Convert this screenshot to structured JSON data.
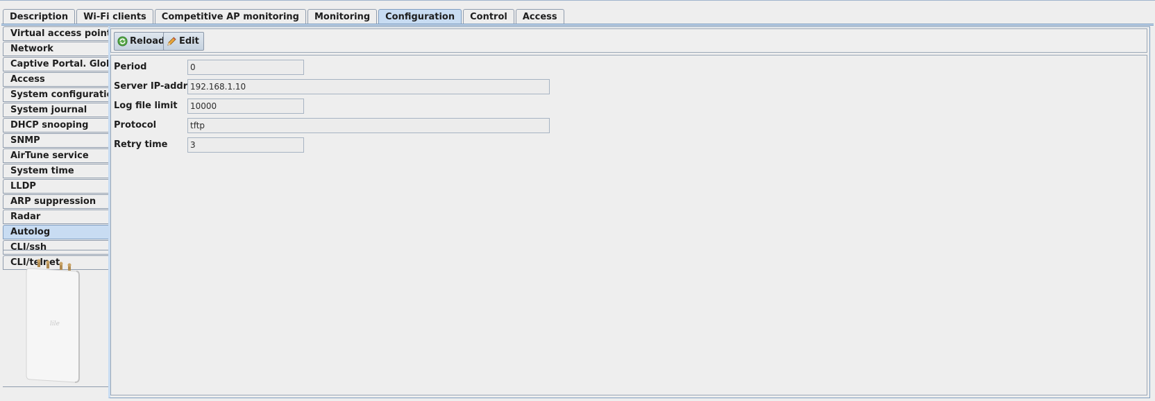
{
  "tabs": [
    {
      "label": "Description",
      "active": false
    },
    {
      "label": "Wi-Fi clients",
      "active": false
    },
    {
      "label": "Competitive AP monitoring",
      "active": false
    },
    {
      "label": "Monitoring",
      "active": false
    },
    {
      "label": "Configuration",
      "active": true
    },
    {
      "label": "Control",
      "active": false
    },
    {
      "label": "Access",
      "active": false
    }
  ],
  "sidebar": {
    "items": [
      {
        "label": "Virtual access points"
      },
      {
        "label": "Network"
      },
      {
        "label": "Captive Portal. Global"
      },
      {
        "label": "Access"
      },
      {
        "label": "System configuration"
      },
      {
        "label": "System journal"
      },
      {
        "label": "DHCP snooping"
      },
      {
        "label": "SNMP"
      },
      {
        "label": "AirTune service"
      },
      {
        "label": "System time"
      },
      {
        "label": "LLDP"
      },
      {
        "label": "ARP suppression"
      },
      {
        "label": "Radar"
      },
      {
        "label": "Autolog"
      },
      {
        "label": "CLI/ssh"
      },
      {
        "label": "CLI/telnet"
      }
    ],
    "active_item": "Autolog",
    "device_image": "access-point-device"
  },
  "toolbar": {
    "reload_label": "Reload",
    "reload_icon": "refresh-icon",
    "edit_label": "Edit",
    "edit_icon": "pencil-icon"
  },
  "form": {
    "period": {
      "label": "Period",
      "value": "0"
    },
    "server_ip": {
      "label": "Server IP-address",
      "value": "192.168.1.10"
    },
    "log_file_limit": {
      "label": "Log file limit",
      "value": "10000"
    },
    "protocol": {
      "label": "Protocol",
      "value": "tftp"
    },
    "retry_time": {
      "label": "Retry time",
      "value": "3"
    }
  },
  "colors": {
    "active_tab": "#c8dcf2",
    "background": "#eeeeee",
    "border": "#8f9cad"
  }
}
